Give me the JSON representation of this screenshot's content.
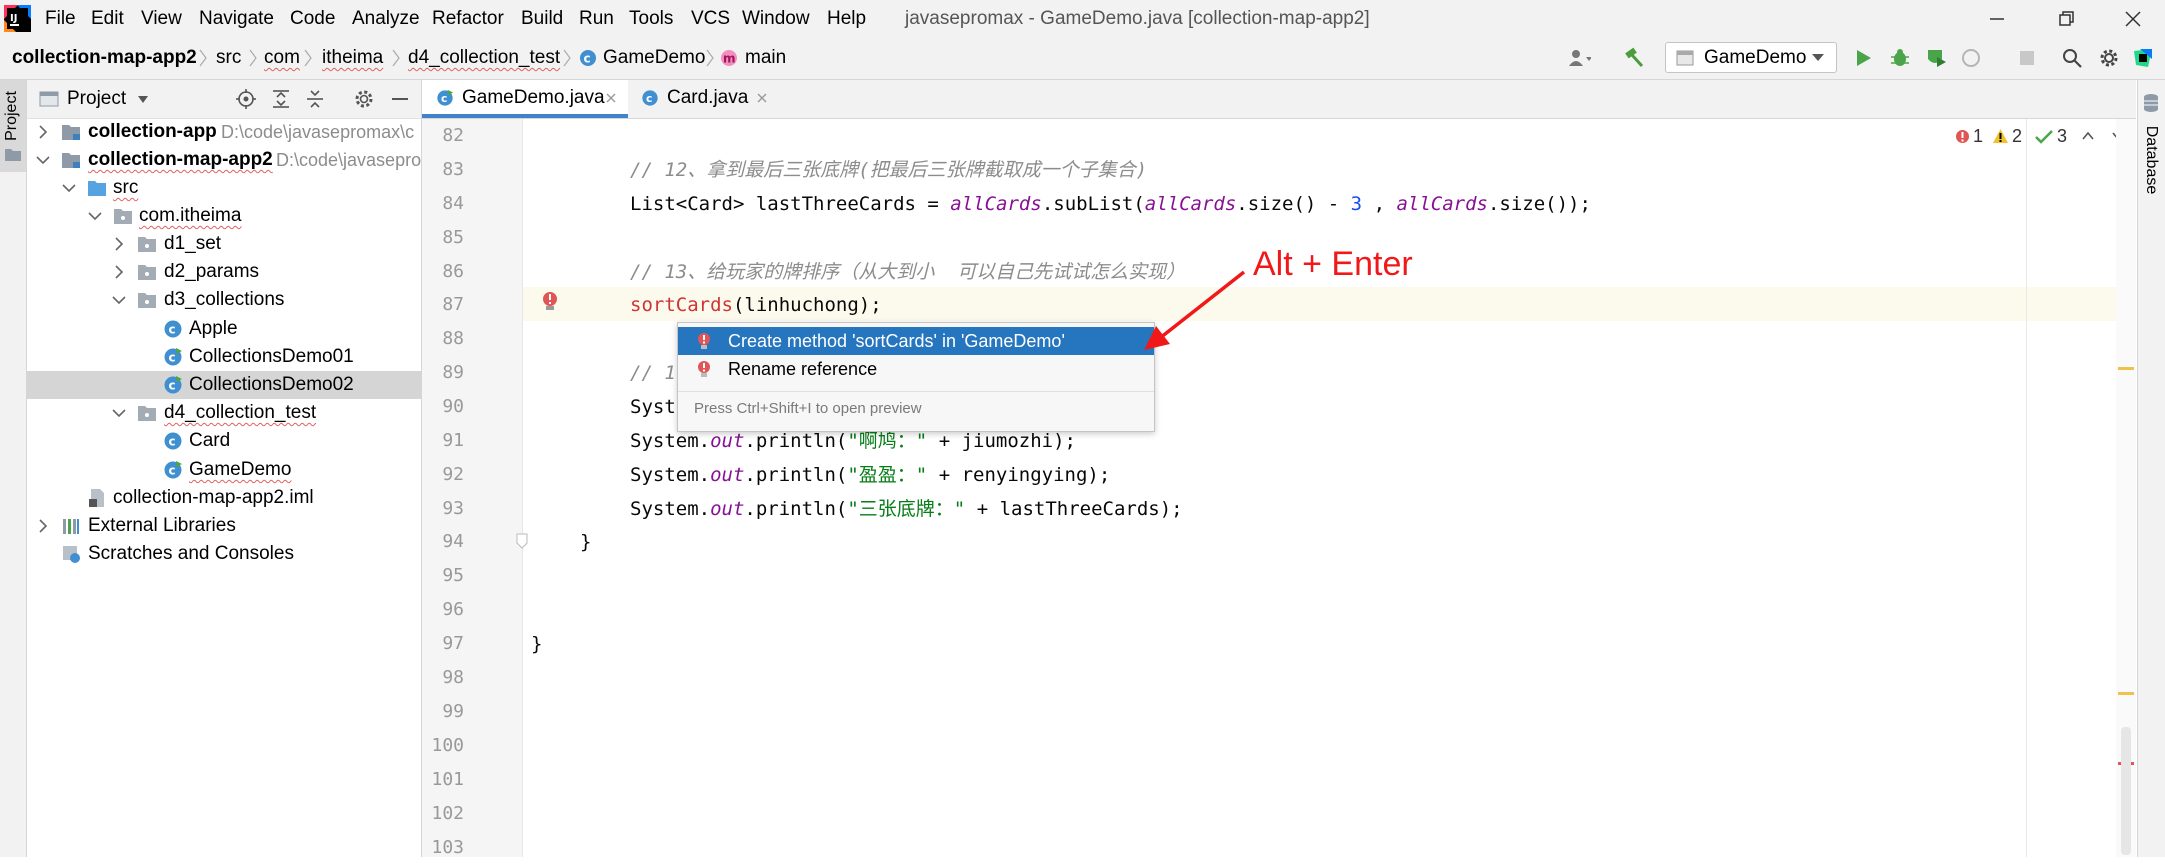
{
  "menu": {
    "items": [
      "File",
      "Edit",
      "View",
      "Navigate",
      "Code",
      "Analyze",
      "Refactor",
      "Build",
      "Run",
      "Tools",
      "VCS",
      "Window",
      "Help"
    ],
    "window_title": "javasepromax - GameDemo.java [collection-map-app2]"
  },
  "breadcrumb": {
    "items": [
      "collection-map-app2",
      "src",
      "com",
      "itheima",
      "d4_collection_test",
      "GameDemo",
      "main"
    ]
  },
  "toolbar": {
    "run_config": "GameDemo"
  },
  "left_strip": {
    "label": "Project"
  },
  "right_strip": {
    "label": "Database"
  },
  "project": {
    "title": "Project",
    "tree": [
      {
        "label": "collection-app",
        "path": "D:\\code\\javasepromax\\c"
      },
      {
        "label": "collection-map-app2",
        "path": "D:\\code\\javasepro"
      },
      {
        "label": "src"
      },
      {
        "label": "com.itheima"
      },
      {
        "label": "d1_set"
      },
      {
        "label": "d2_params"
      },
      {
        "label": "d3_collections"
      },
      {
        "label": "Apple"
      },
      {
        "label": "CollectionsDemo01"
      },
      {
        "label": "CollectionsDemo02"
      },
      {
        "label": "d4_collection_test"
      },
      {
        "label": "Card"
      },
      {
        "label": "GameDemo"
      },
      {
        "label": "collection-map-app2.iml"
      },
      {
        "label": "External Libraries"
      },
      {
        "label": "Scratches and Consoles"
      }
    ]
  },
  "tabs": [
    {
      "label": "GameDemo.java"
    },
    {
      "label": "Card.java"
    }
  ],
  "inspections": {
    "errors": "1",
    "warnings": "2",
    "weak": "3"
  },
  "editor": {
    "line_numbers": [
      "82",
      "83",
      "84",
      "85",
      "86",
      "87",
      "88",
      "89",
      "90",
      "91",
      "92",
      "93",
      "94",
      "95",
      "96",
      "97",
      "98",
      "99",
      "100",
      "101",
      "102",
      "103"
    ],
    "lines": {
      "l83": "// 12、拿到最后三张底牌(把最后三张牌截取成一个子集合)",
      "l84": {
        "p1": "List<Card> lastThreeCards = ",
        "f1": "allCards",
        "p2": ".subList(",
        "f2": "allCards",
        "p3": ".size() - ",
        "n1": "3",
        "p4": " , ",
        "f3": "allCards",
        "p5": ".size());"
      },
      "l86": "// 13、给玩家的牌排序（从大到小  可以自己先试试怎么实现）",
      "l87": {
        "call": "sortCards",
        "rest": "(linhuchong);"
      },
      "l89": "// 1",
      "l90": "Syst",
      "l91": {
        "p1": "System.",
        "f1": "out",
        "p2": ".println(",
        "s1": "\"啊鸠：\"",
        "p3": " + jiumozhi);"
      },
      "l92": {
        "p1": "System.",
        "f1": "out",
        "p2": ".println(",
        "s1": "\"盈盈：\"",
        "p3": " + renyingying);"
      },
      "l93": {
        "p1": "System.",
        "f1": "out",
        "p2": ".println(",
        "s1": "\"三张底牌：\"",
        "p3": " + lastThreeCards);"
      },
      "l94": "}",
      "l97": "}"
    }
  },
  "popup": {
    "items": [
      {
        "label": "Create method 'sortCards' in 'GameDemo'"
      },
      {
        "label": "Rename reference"
      }
    ],
    "hint": "Press Ctrl+Shift+I to open preview"
  },
  "annotation": {
    "text": "Alt + Enter",
    "color": "#f01818"
  },
  "colors": {
    "accent": "#2675bf",
    "tab_underline": "#4083c9",
    "error": "#cf3434"
  }
}
